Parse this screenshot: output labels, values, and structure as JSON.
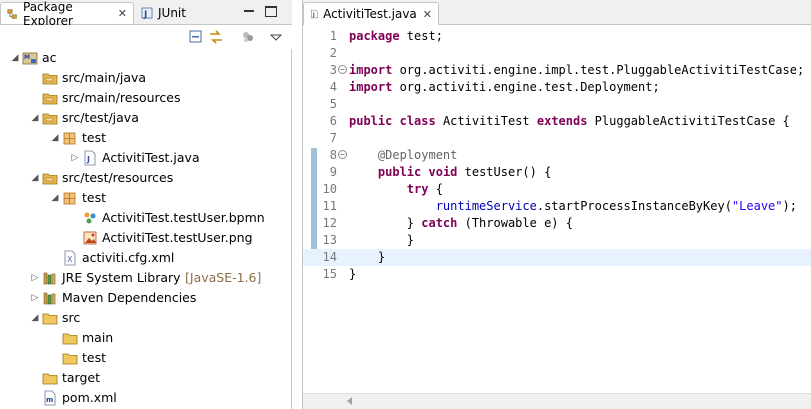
{
  "left_tabs": {
    "package_explorer": "Package Explorer",
    "junit": "JUnit",
    "close_glyph": "✕"
  },
  "tree": [
    {
      "label": "ac",
      "icon": "project-icon",
      "level": 0,
      "twisty": "expanded"
    },
    {
      "label": "src/main/java",
      "icon": "source-folder-icon",
      "level": 1,
      "twisty": "none"
    },
    {
      "label": "src/main/resources",
      "icon": "source-folder-icon",
      "level": 1,
      "twisty": "none"
    },
    {
      "label": "src/test/java",
      "icon": "source-folder-icon",
      "level": 1,
      "twisty": "expanded"
    },
    {
      "label": "test",
      "icon": "package-icon",
      "level": 2,
      "twisty": "expanded"
    },
    {
      "label": "ActivitiTest.java",
      "icon": "java-file-icon",
      "level": 3,
      "twisty": "collapsed"
    },
    {
      "label": "src/test/resources",
      "icon": "source-folder-icon",
      "level": 1,
      "twisty": "expanded"
    },
    {
      "label": "test",
      "icon": "package-icon",
      "level": 2,
      "twisty": "expanded"
    },
    {
      "label": "ActivitiTest.testUser.bpmn",
      "icon": "bpmn-file-icon",
      "level": 3,
      "twisty": "none"
    },
    {
      "label": "ActivitiTest.testUser.png",
      "icon": "image-file-icon",
      "level": 3,
      "twisty": "none"
    },
    {
      "label": "activiti.cfg.xml",
      "icon": "xml-file-icon",
      "level": 2,
      "twisty": "none"
    },
    {
      "label": "JRE System Library",
      "decoration": "[JavaSE-1.6]",
      "icon": "library-icon",
      "level": 1,
      "twisty": "collapsed"
    },
    {
      "label": "Maven Dependencies",
      "icon": "library-icon",
      "level": 1,
      "twisty": "collapsed"
    },
    {
      "label": "src",
      "icon": "folder-icon",
      "level": 1,
      "twisty": "expanded"
    },
    {
      "label": "main",
      "icon": "folder-icon",
      "level": 2,
      "twisty": "none"
    },
    {
      "label": "test",
      "icon": "folder-icon",
      "level": 2,
      "twisty": "none"
    },
    {
      "label": "target",
      "icon": "folder-icon",
      "level": 1,
      "twisty": "none"
    },
    {
      "label": "pom.xml",
      "icon": "maven-pom-icon",
      "level": 1,
      "twisty": "none"
    }
  ],
  "editor": {
    "tab_label": "ActivitiTest.java",
    "close_glyph": "✕",
    "current_line": 14,
    "lines": [
      {
        "n": "1",
        "fold": "",
        "tokens": [
          {
            "t": "package",
            "c": "kw"
          },
          {
            "t": " test;",
            "c": ""
          }
        ]
      },
      {
        "n": "2",
        "fold": "",
        "tokens": []
      },
      {
        "n": "3",
        "fold": "−",
        "tokens": [
          {
            "t": "import",
            "c": "kw"
          },
          {
            "t": " org.activiti.engine.impl.test.PluggableActivitiTestCase;",
            "c": ""
          }
        ]
      },
      {
        "n": "4",
        "fold": "",
        "tokens": [
          {
            "t": "import",
            "c": "kw"
          },
          {
            "t": " org.activiti.engine.test.Deployment;",
            "c": ""
          }
        ]
      },
      {
        "n": "5",
        "fold": "",
        "tokens": []
      },
      {
        "n": "6",
        "fold": "",
        "tokens": [
          {
            "t": "public",
            "c": "kw"
          },
          {
            "t": " ",
            "c": ""
          },
          {
            "t": "class",
            "c": "kw"
          },
          {
            "t": " ActivitiTest ",
            "c": ""
          },
          {
            "t": "extends",
            "c": "kw"
          },
          {
            "t": " PluggableActivitiTestCase {",
            "c": ""
          }
        ]
      },
      {
        "n": "7",
        "fold": "",
        "tokens": []
      },
      {
        "n": "8",
        "fold": "−",
        "tokens": [
          {
            "t": "    ",
            "c": ""
          },
          {
            "t": "@Deployment",
            "c": "ann"
          }
        ]
      },
      {
        "n": "9",
        "fold": "",
        "tokens": [
          {
            "t": "    ",
            "c": ""
          },
          {
            "t": "public",
            "c": "kw"
          },
          {
            "t": " ",
            "c": ""
          },
          {
            "t": "void",
            "c": "kw"
          },
          {
            "t": " testUser() {",
            "c": ""
          }
        ]
      },
      {
        "n": "10",
        "fold": "",
        "tokens": [
          {
            "t": "        ",
            "c": ""
          },
          {
            "t": "try",
            "c": "kw"
          },
          {
            "t": " {",
            "c": ""
          }
        ]
      },
      {
        "n": "11",
        "fold": "",
        "tokens": [
          {
            "t": "            ",
            "c": ""
          },
          {
            "t": "runtimeService",
            "c": "fld"
          },
          {
            "t": ".startProcessInstanceByKey(",
            "c": ""
          },
          {
            "t": "\"Leave\"",
            "c": "str"
          },
          {
            "t": ");",
            "c": ""
          }
        ]
      },
      {
        "n": "12",
        "fold": "",
        "tokens": [
          {
            "t": "        } ",
            "c": ""
          },
          {
            "t": "catch",
            "c": "kw"
          },
          {
            "t": " (Throwable e) {",
            "c": ""
          }
        ]
      },
      {
        "n": "13",
        "fold": "",
        "tokens": [
          {
            "t": "        }",
            "c": ""
          }
        ]
      },
      {
        "n": "14",
        "fold": "",
        "tokens": [
          {
            "t": "    }",
            "c": ""
          }
        ]
      },
      {
        "n": "15",
        "fold": "",
        "tokens": [
          {
            "t": "}",
            "c": ""
          }
        ]
      }
    ]
  },
  "colors": {
    "keyword": "#7f0055",
    "annotation": "#646464",
    "field": "#0000c0",
    "string": "#2a00ff",
    "current_line": "#e8f2fe",
    "change_ruler": "#9fc3d6"
  }
}
